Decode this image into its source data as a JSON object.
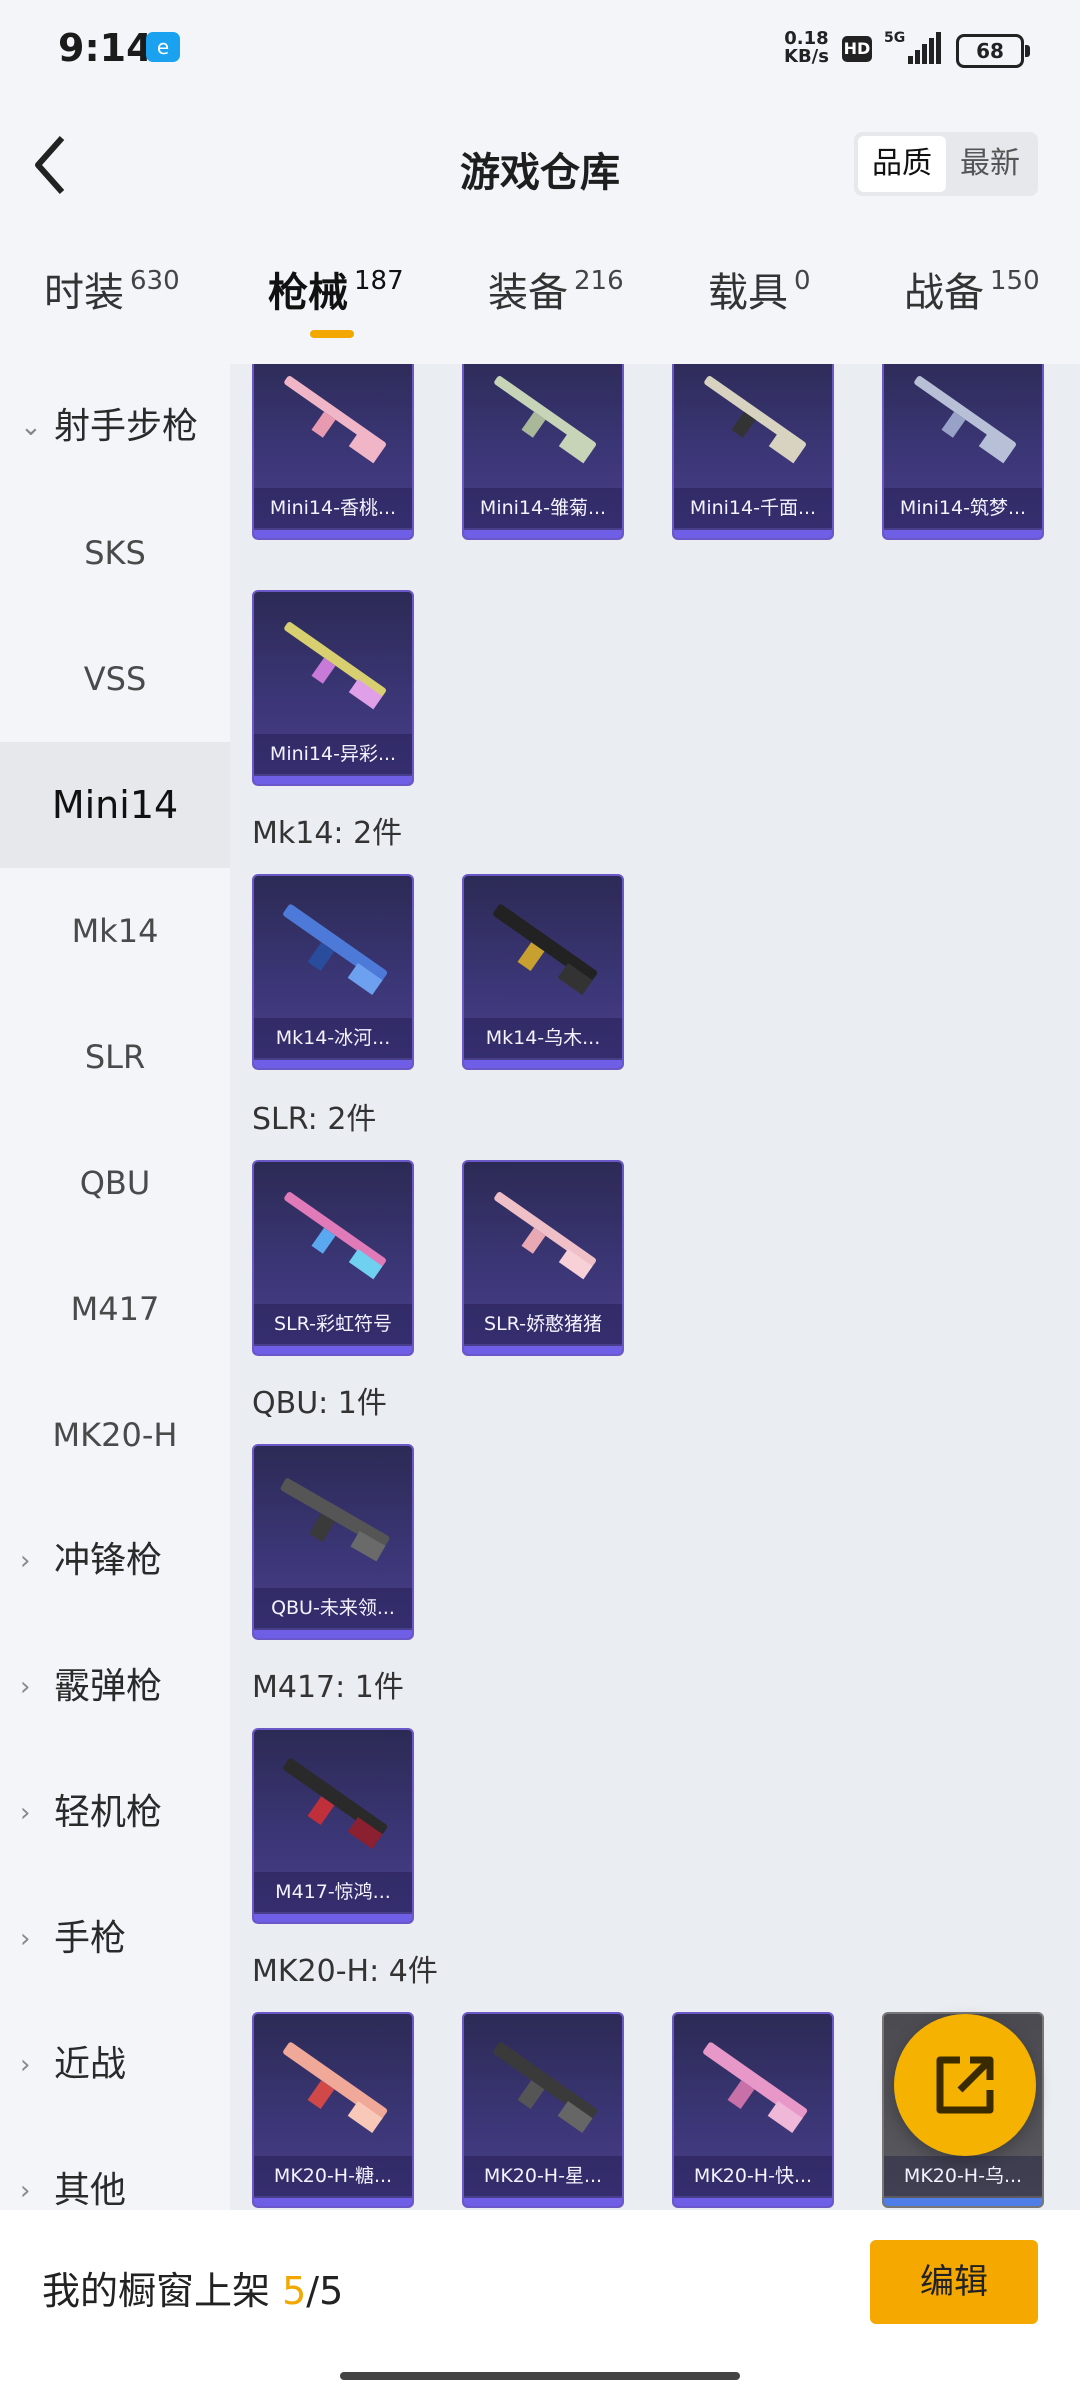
{
  "status": {
    "time": "9:14",
    "app_badge": "e",
    "speed_top": "0.18",
    "speed_bottom": "KB/s",
    "hd": "HD",
    "net": "5G",
    "battery": "68"
  },
  "header": {
    "title": "游戏仓库",
    "sort_quality": "品质",
    "sort_latest": "最新"
  },
  "tabs": [
    {
      "label": "时装",
      "count": "630"
    },
    {
      "label": "枪械",
      "count": "187"
    },
    {
      "label": "装备",
      "count": "216"
    },
    {
      "label": "载具",
      "count": "0"
    },
    {
      "label": "战备",
      "count": "150"
    }
  ],
  "sidebar": {
    "group_open": "射手步枪",
    "sub_items": [
      "SKS",
      "VSS",
      "Mini14",
      "Mk14",
      "SLR",
      "QBU",
      "M417",
      "MK20-H"
    ],
    "groups": [
      "冲锋枪",
      "霰弹枪",
      "轻机枪",
      "手枪",
      "近战",
      "其他"
    ]
  },
  "content": {
    "row_top": [
      "Mini14-香桃...",
      "Mini14-雏菊...",
      "Mini14-千面...",
      "Mini14-筑梦..."
    ],
    "mini14_extra": [
      "Mini14-异彩..."
    ],
    "mk14_header": "Mk14: 2件",
    "mk14": [
      "Mk14-冰河...",
      "Mk14-乌木..."
    ],
    "slr_header": "SLR: 2件",
    "slr": [
      "SLR-彩虹符号",
      "SLR-娇憨猪猪"
    ],
    "qbu_header": "QBU: 1件",
    "qbu": [
      "QBU-未来领..."
    ],
    "m417_header": "M417: 1件",
    "m417": [
      "M417-惊鸿..."
    ],
    "mk20_header": "MK20-H: 4件",
    "mk20": [
      "MK20-H-糖...",
      "MK20-H-星...",
      "MK20-H-快...",
      "MK20-H-乌..."
    ]
  },
  "bottom": {
    "label_prefix": "我的橱窗上架 ",
    "count_current": "5",
    "count_sep": "/",
    "count_total": "5",
    "edit_label": "编辑"
  },
  "colors": {
    "accent": "#f5a800",
    "card_border": "#6a58c8"
  }
}
